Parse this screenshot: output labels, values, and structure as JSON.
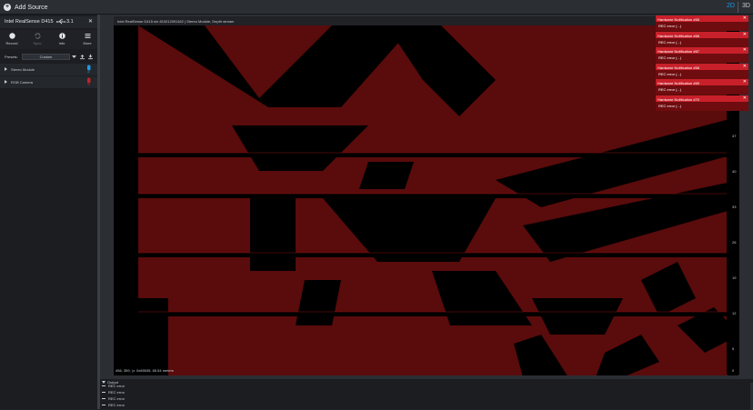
{
  "topbar": {
    "add_source_label": "Add Source",
    "view_2d": "2D",
    "view_3d": "3D"
  },
  "device": {
    "name": "Intel RealSense D415",
    "usb_version": "3.1"
  },
  "toolbar": [
    {
      "label": "Record",
      "icon": "record-icon",
      "enabled": true
    },
    {
      "label": "Sync",
      "icon": "sync-icon",
      "enabled": false
    },
    {
      "label": "Info",
      "icon": "info-icon",
      "enabled": true
    },
    {
      "label": "More",
      "icon": "menu-icon",
      "enabled": true
    }
  ],
  "presets": {
    "label": "Presets:",
    "value": "Custom"
  },
  "sensors": [
    {
      "name": "Stereo Module",
      "state": "on",
      "state_color": "#1e9be3"
    },
    {
      "name": "RGB Camera",
      "state": "off",
      "state_color": "#c8202a"
    }
  ],
  "stream": {
    "title": "Intel RealSense D415 s/n 813212091162 | Stereo Module, Depth stream",
    "readout": "456, 359, 'p: 0x65535, 65.54 meters"
  },
  "scale_ticks": [
    "47",
    "40",
    "33",
    "26",
    "19",
    "12",
    "5",
    "0"
  ],
  "notifications": [
    {
      "title": "Hardware Notification #65",
      "body": "REC error  (...)"
    },
    {
      "title": "Hardware Notification #66",
      "body": "REC error  (...)"
    },
    {
      "title": "Hardware Notification #67",
      "body": "REC error  (...)"
    },
    {
      "title": "Hardware Notification #68",
      "body": "REC error  (...)"
    },
    {
      "title": "Hardware Notification #69",
      "body": "REC error  (...)"
    },
    {
      "title": "Hardware Notification #70",
      "body": "REC error  (...)"
    }
  ],
  "output": {
    "label": "Output",
    "lines": [
      "REC error",
      "REC error",
      "REC error",
      "REC error"
    ]
  },
  "colors": {
    "accent": "#1e9be3",
    "error": "#c8202a",
    "depth": "#5a0b0b"
  }
}
